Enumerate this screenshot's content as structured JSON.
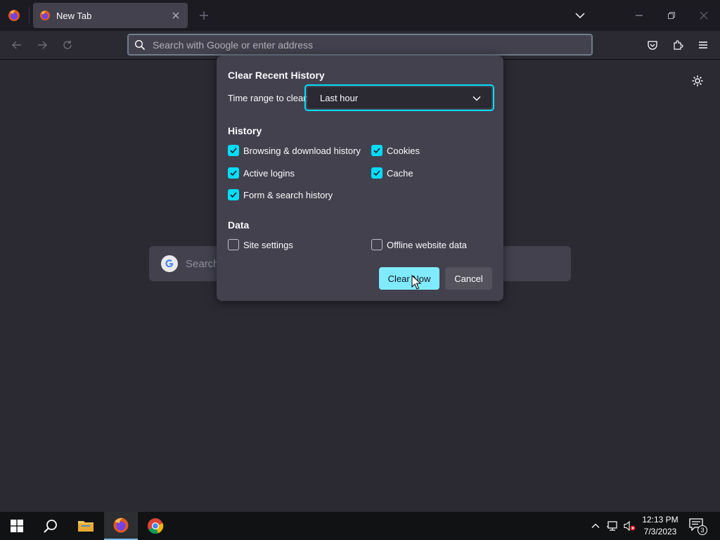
{
  "browser": {
    "tab_title": "New Tab",
    "url_placeholder": "Search with Google or enter address"
  },
  "newtab": {
    "search_placeholder": "Search"
  },
  "dialog": {
    "title": "Clear Recent History",
    "time_range_label": "Time range to clear:",
    "time_range_value": "Last hour",
    "history_title": "History",
    "history_items": [
      {
        "label": "Browsing & download history",
        "checked": true
      },
      {
        "label": "Cookies",
        "checked": true
      },
      {
        "label": "Active logins",
        "checked": true
      },
      {
        "label": "Cache",
        "checked": true
      },
      {
        "label": "Form & search history",
        "checked": true
      }
    ],
    "data_title": "Data",
    "data_items": [
      {
        "label": "Site settings",
        "checked": false
      },
      {
        "label": "Offline website data",
        "checked": false
      }
    ],
    "clear_button": "Clear Now",
    "cancel_button": "Cancel"
  },
  "taskbar": {
    "time": "12:13 PM",
    "date": "7/3/2023",
    "notification_count": "3"
  },
  "colors": {
    "accent": "#00ddff",
    "primary_button": "#80ebff",
    "dialog_bg": "#42414d",
    "page_bg": "#2b2a33"
  }
}
